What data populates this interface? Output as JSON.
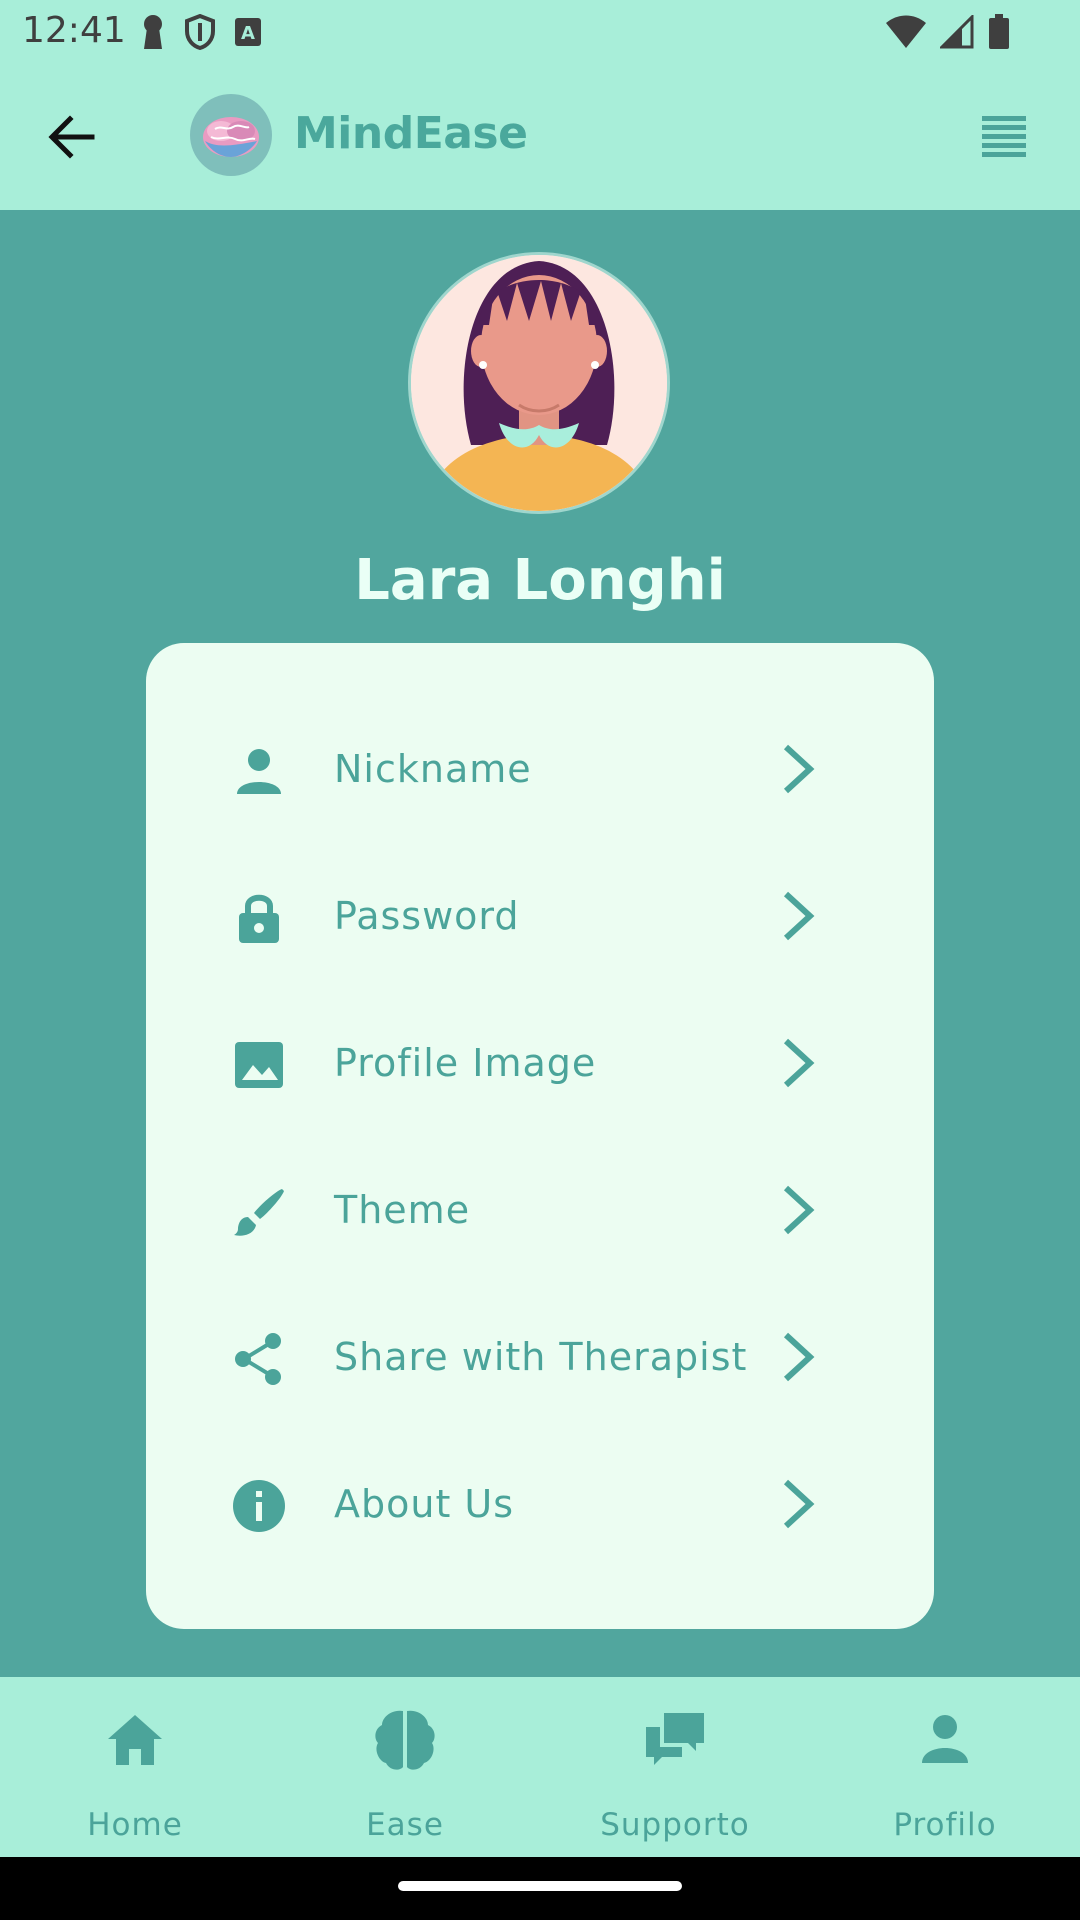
{
  "status_bar": {
    "time": "12:41"
  },
  "app_bar": {
    "title": "MindEase"
  },
  "profile": {
    "name": "Lara Longhi"
  },
  "settings": [
    {
      "label": "Nickname",
      "icon": "person-icon"
    },
    {
      "label": "Password",
      "icon": "lock-icon"
    },
    {
      "label": "Profile Image",
      "icon": "image-icon"
    },
    {
      "label": "Theme",
      "icon": "brush-icon"
    },
    {
      "label": "Share with Therapist",
      "icon": "share-icon"
    },
    {
      "label": "About Us",
      "icon": "info-icon"
    }
  ],
  "bottom_nav": [
    {
      "label": "Home",
      "icon": "home-icon"
    },
    {
      "label": "Ease",
      "icon": "brain-icon"
    },
    {
      "label": "Supporto",
      "icon": "chat-icon"
    },
    {
      "label": "Profilo",
      "icon": "person-icon"
    }
  ],
  "colors": {
    "header_bg": "#a8eed9",
    "page_bg": "#51a69e",
    "card_bg": "#ecfdf2",
    "accent": "#4ba49a"
  }
}
